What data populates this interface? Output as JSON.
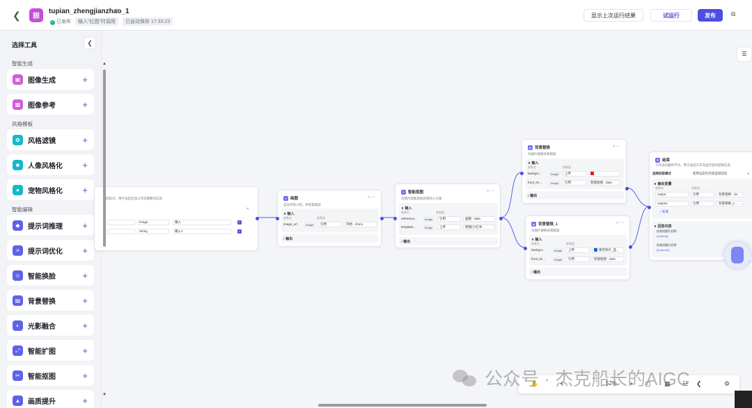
{
  "header": {
    "back_icon": "arrow-left-icon",
    "app_title": "tupian_zhengjianzhao_1",
    "published": "已发布",
    "trigger_hint": "输入\"扛图\"时调用",
    "autosave": "已自动保存 17:33:23",
    "btn_last_result": "显示上次运行结果",
    "btn_test_run": "试运行",
    "btn_publish": "发布"
  },
  "sidebar": {
    "title": "选择工具",
    "categories": [
      {
        "label": "智能生成",
        "items": [
          "图像生成",
          "图像参考"
        ]
      },
      {
        "label": "风格模板",
        "items": [
          "风格滤镜",
          "人像风格化",
          "宠物风格化"
        ]
      },
      {
        "label": "智能编辑",
        "items": [
          "提示词推理",
          "提示词优化",
          "智能换脸",
          "背景替换",
          "光影融合",
          "智能扩图",
          "智能抠图",
          "画质提升"
        ]
      }
    ]
  },
  "nodes": {
    "start": {
      "desc": "的起点，用于设定启动工作流需要的信息",
      "rows": [
        {
          "type": "Image",
          "value": "输入"
        },
        {
          "type": "String",
          "value": "输入1"
        }
      ]
    },
    "code": {
      "title": "画图",
      "desc": "自动识别人脸，并智能裁剪",
      "input_label": "输入",
      "col_name": "参数名",
      "col_value": "参数值",
      "row": {
        "name": "image_url",
        "type": "Image",
        "mode": "引用",
        "ref": "开始 - shuru"
      },
      "output_label": "输出"
    },
    "cutout": {
      "title": "智能抠图",
      "desc": "为图片智能添加背景的人头图",
      "input_label": "输入",
      "col_name": "参数名",
      "col_value": "参数值",
      "rows": [
        {
          "name": "reference...",
          "type": "Image",
          "mode": "引用",
          "ref": "画图 - data"
        },
        {
          "name": "template...",
          "type": "Image",
          "mode": "上传",
          "ref": "原图(小红书..."
        }
      ],
      "output_label": "输出"
    },
    "bg1": {
      "title": "背景替换",
      "desc": "为图片替换背景图案",
      "input_label": "输入",
      "col_name": "参数名",
      "col_value": "参数值",
      "rows": [
        {
          "name": "backgro...",
          "type": "Image",
          "mode": "上传",
          "ref": ""
        },
        {
          "name": "front_im...",
          "type": "Image",
          "mode": "引用",
          "ref": "智能抠图 - data"
        }
      ],
      "output_label": "输出"
    },
    "bg2": {
      "title": "背景替换_1",
      "desc": "为图片替换背景图案",
      "input_label": "输入",
      "col_name": "参数名",
      "col_value": "参数值",
      "rows": [
        {
          "name": "backgro...",
          "type": "Image",
          "mode": "上传",
          "ref": "便衣照片_蓝..."
        },
        {
          "name": "front_im...",
          "type": "Image",
          "mode": "引用",
          "ref": "智能抠图 - data"
        }
      ],
      "output_label": "输出"
    },
    "end": {
      "title": "结束",
      "desc": "工作流的最终节点，用于返回工作流运行后的结果信息",
      "mode_label": "选择回答模式",
      "mode_value": "使用设定的内容直接回答",
      "output_label": "输出变量",
      "col_name": "参数名",
      "col_value": "参数值",
      "rows": [
        {
          "name": "output",
          "mode": "引用",
          "ref": "背景替换 - da"
        },
        {
          "name": "output1",
          "mode": "引用",
          "ref": "背景替换_1 - ..."
        }
      ],
      "add_label": "新增",
      "answer_label": "回答内容",
      "answer_lines": [
        "仅测试图片证明：",
        "{{output}}",
        "仅测试图片证明：",
        "{{output1}}"
      ]
    }
  },
  "toolbar": {
    "zoom": "52%"
  },
  "watermark": "公众号 · 杰克船长的AIGC",
  "colors": {
    "accent": "#4c4fe0",
    "published": "#22b07d",
    "red_swatch": "#e01b1b",
    "blue_swatch": "#1a5fd9"
  }
}
